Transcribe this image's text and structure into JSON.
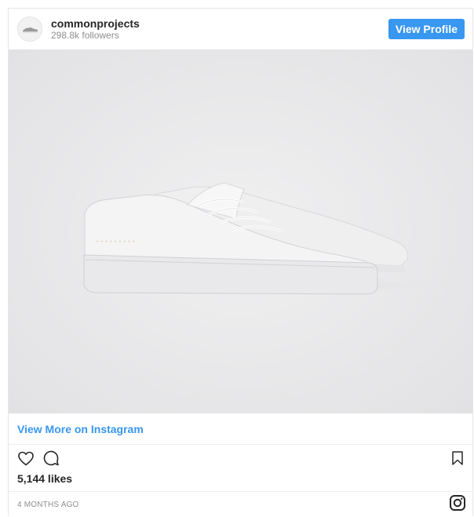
{
  "profile": {
    "username": "commonprojects",
    "followers": "298.8k followers",
    "view_profile_label": "View Profile"
  },
  "post": {
    "image_icon": "sneaker-photo",
    "view_more_label": "View More on Instagram",
    "likes": "5,144 likes",
    "timestamp": "4 MONTHS AGO"
  },
  "icons": {
    "like": "heart-icon",
    "comment": "comment-icon",
    "save": "bookmark-icon",
    "brand": "instagram-icon"
  },
  "colors": {
    "accent": "#3897f0",
    "text": "#262626",
    "muted": "#8e8e8e",
    "border": "#efefef"
  }
}
